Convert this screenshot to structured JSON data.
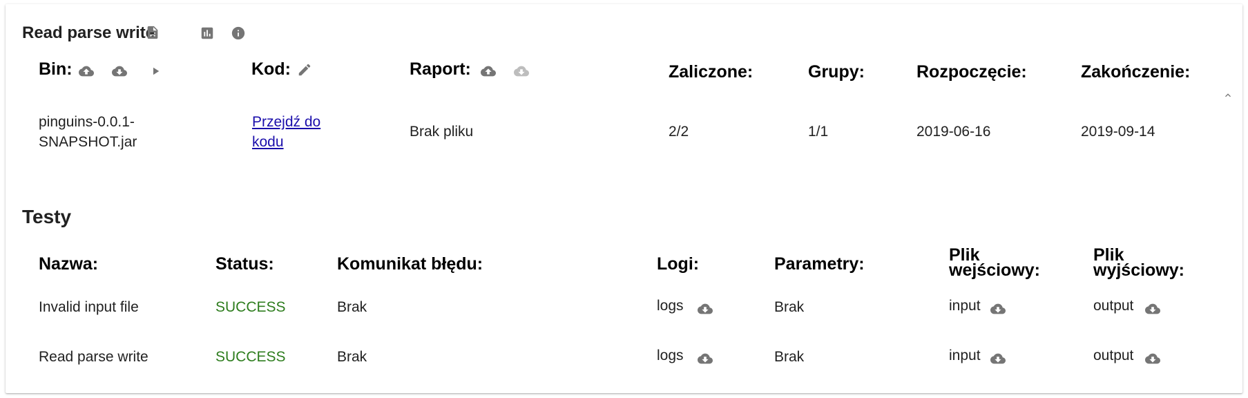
{
  "card": {
    "title": "Read parse write",
    "icons": [
      "document-icon",
      "chart-icon",
      "info-icon"
    ]
  },
  "summary": {
    "headers": {
      "bin": "Bin:",
      "kod": "Kod:",
      "raport": "Raport:",
      "zaliczone": "Zaliczone:",
      "grupy": "Grupy:",
      "rozpoczecie": "Rozpoczęcie:",
      "zakonczenie": "Zakończenie:"
    },
    "row": {
      "bin_line1": "pinguins-0.0.1-",
      "bin_line2": "SNAPSHOT.jar",
      "kod_link_line1": "Przejdź do",
      "kod_link_line2": "kodu",
      "raport": "Brak pliku",
      "zaliczone": "2/2",
      "grupy": "1/1",
      "rozpoczecie": "2019-06-16",
      "zakonczenie": "2019-09-14"
    }
  },
  "tests": {
    "title": "Testy",
    "headers": {
      "nazwa": "Nazwa:",
      "status": "Status:",
      "komunikat": "Komunikat błędu:",
      "logi": "Logi:",
      "parametry": "Parametry:",
      "plik_wej_1": "Plik",
      "plik_wej_2": "wejściowy:",
      "plik_wyj_1": "Plik",
      "plik_wyj_2": "wyjściowy:"
    },
    "rows": [
      {
        "nazwa": "Invalid input file",
        "status": "SUCCESS",
        "komunikat": "Brak",
        "logi": "logs",
        "parametry": "Brak",
        "input": "input",
        "output": "output"
      },
      {
        "nazwa": "Read parse write",
        "status": "SUCCESS",
        "komunikat": "Brak",
        "logi": "logs",
        "parametry": "Brak",
        "input": "input",
        "output": "output"
      }
    ]
  },
  "colors": {
    "success": "#2e7d1e",
    "link": "#1a0dab",
    "icon": "#757575",
    "icon_disabled": "#bdbdbd"
  }
}
